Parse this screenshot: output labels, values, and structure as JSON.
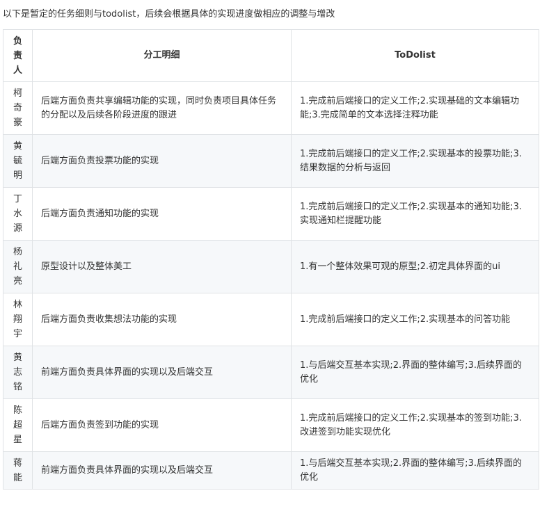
{
  "intro": "以下是暂定的任务细则与todolist，后续会根据具体的实现进度做相应的调整与增改",
  "table": {
    "headers": {
      "person": "负责人",
      "division": "分工明细",
      "todolist": "ToDolist"
    },
    "rows": [
      {
        "person": "柯奇豪",
        "division": "后端方面负责共享编辑功能的实现，同时负责项目具体任务的分配以及后续各阶段进度的跟进",
        "todo": "1.完成前后端接口的定义工作;2.实现基础的文本编辑功能;3.完成简单的文本选择注释功能"
      },
      {
        "person": "黄毓明",
        "division": "后端方面负责投票功能的实现",
        "todo": "1.完成前后端接口的定义工作;2.实现基本的投票功能;3.结果数据的分析与返回"
      },
      {
        "person": "丁水源",
        "division": "后端方面负责通知功能的实现",
        "todo": "1.完成前后端接口的定义工作;2.实现基本的通知功能;3.实现通知栏提醒功能"
      },
      {
        "person": "杨礼亮",
        "division": "原型设计以及整体美工",
        "todo": "1.有一个整体效果可观的原型;2.初定具体界面的ui"
      },
      {
        "person": "林翔宇",
        "division": "后端方面负责收集想法功能的实现",
        "todo": "1.完成前后端接口的定义工作;2.实现基本的问答功能"
      },
      {
        "person": "黄志铭",
        "division": "前端方面负责具体界面的实现以及后端交互",
        "todo": "1.与后端交互基本实现;2.界面的整体编写;3.后续界面的优化"
      },
      {
        "person": "陈超星",
        "division": "后端方面负责签到功能的实现",
        "todo": "1.完成前后端接口的定义工作;2.实现基本的签到功能;3.改进签到功能实现优化"
      },
      {
        "person": "蒋能",
        "division": "前端方面负责具体界面的实现以及后端交互",
        "todo": "1.与后端交互基本实现;2.界面的整体编写;3.后续界面的优化"
      }
    ]
  }
}
